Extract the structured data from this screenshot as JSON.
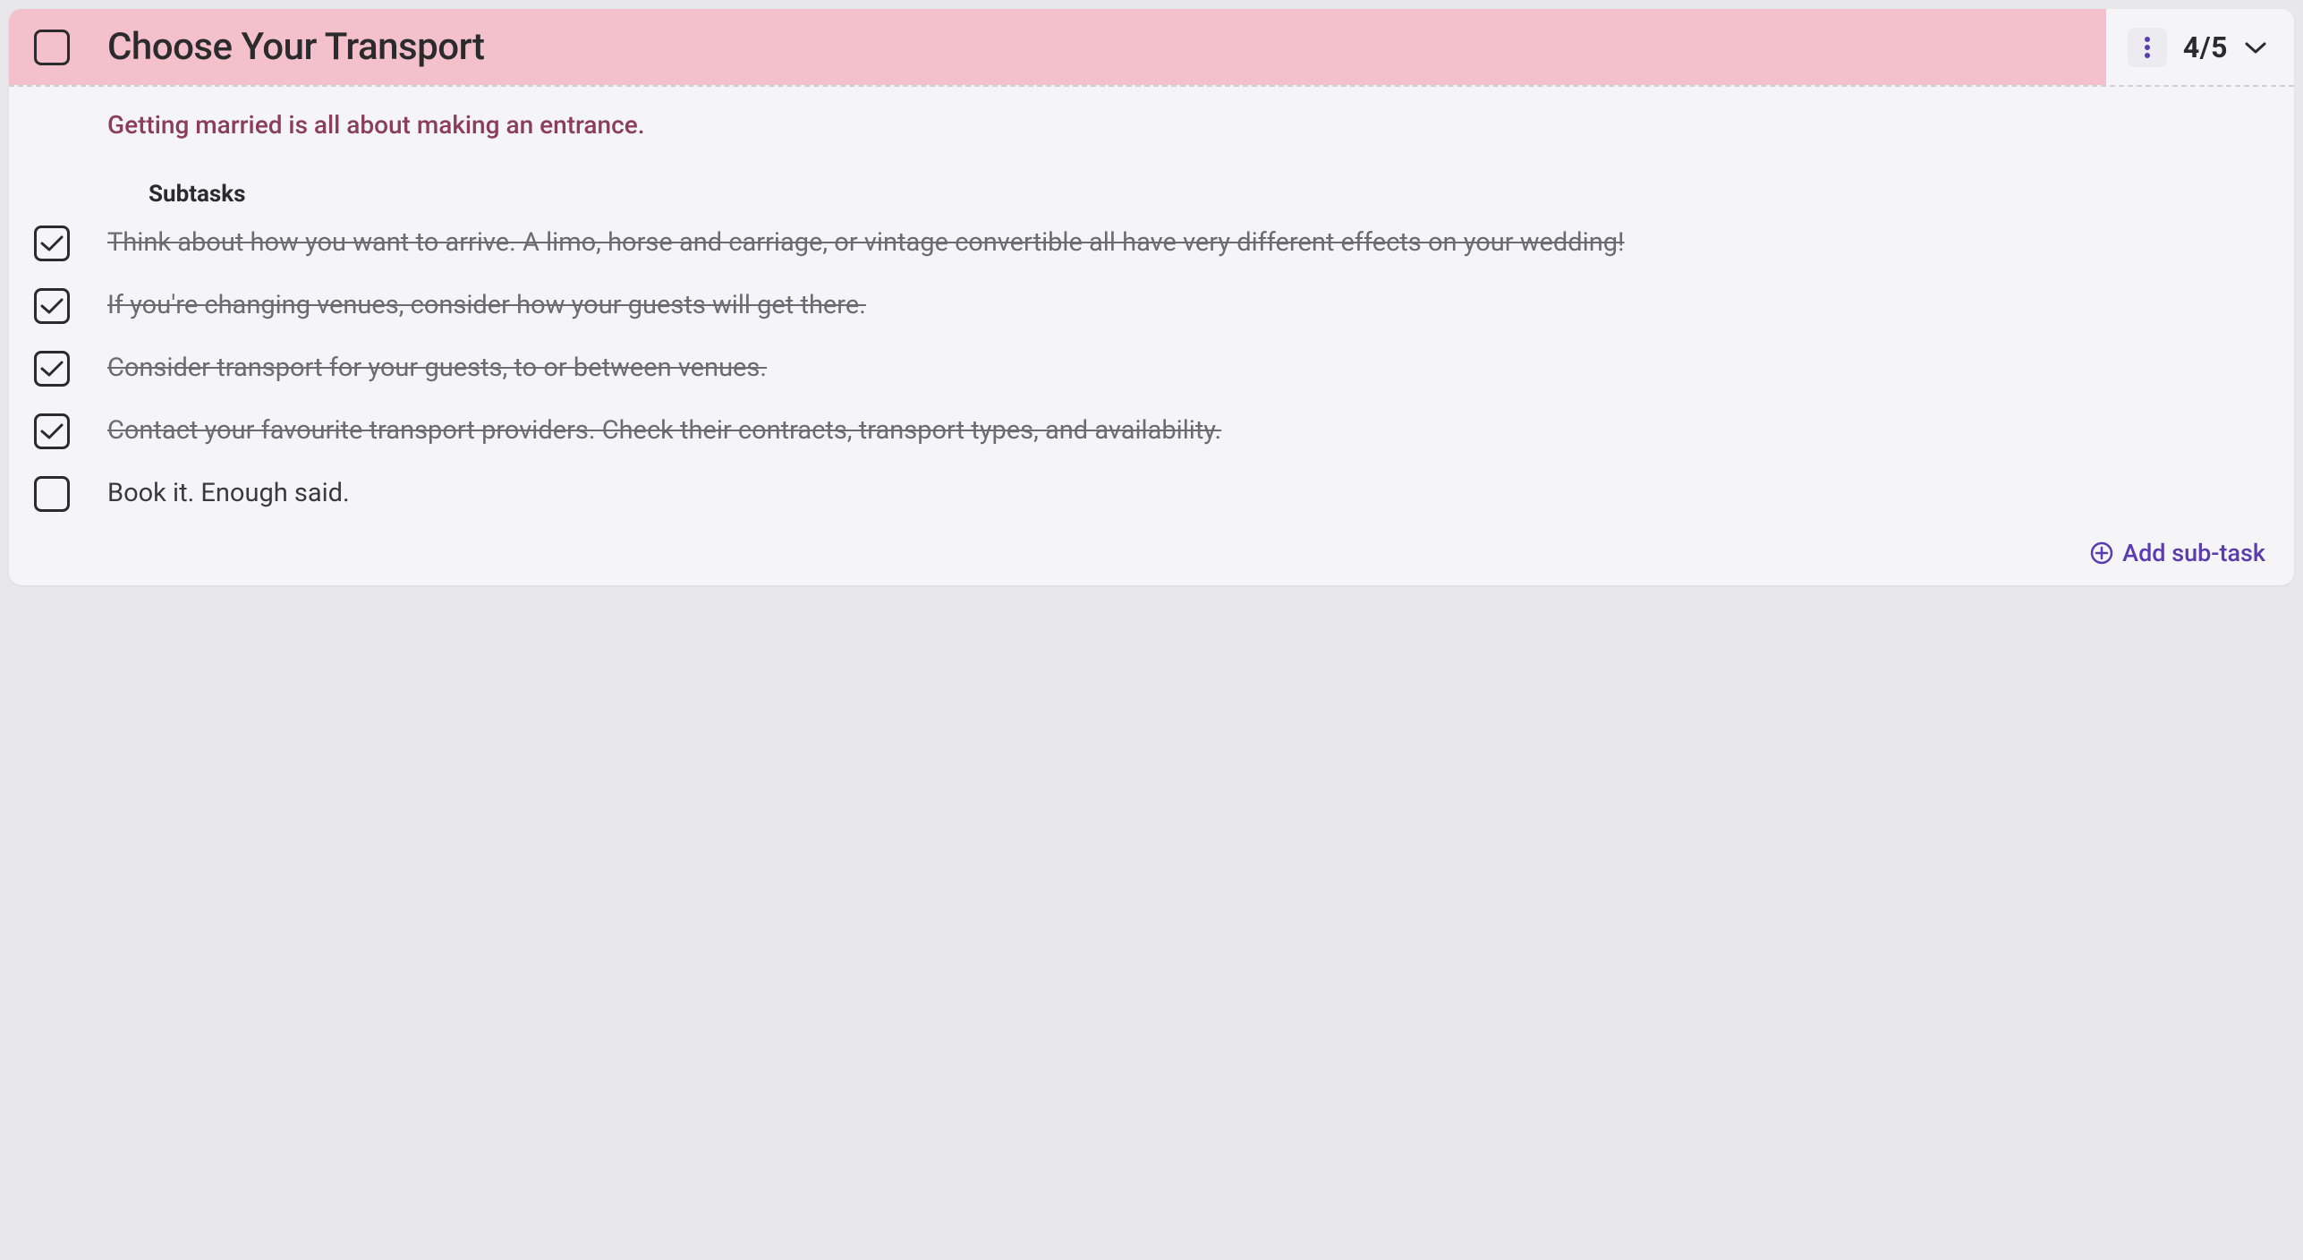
{
  "task": {
    "title": "Choose Your Transport",
    "completed": false,
    "progress": "4/5",
    "description": "Getting married is all about making an entrance."
  },
  "subtasks_heading": "Subtasks",
  "subtasks": [
    {
      "text": "Think about how you want to arrive. A limo, horse and carriage, or vintage convertible all have very different effects on your wedding!",
      "done": true
    },
    {
      "text": "If you're changing venues, consider how your guests will get there.",
      "done": true
    },
    {
      "text": "Consider transport for your guests, to or between venues.",
      "done": true
    },
    {
      "text": "Contact your favourite transport providers. Check their contracts, transport types, and availability.",
      "done": true
    },
    {
      "text": "Book it. Enough said.",
      "done": false
    }
  ],
  "add_subtask_label": "Add sub-task",
  "colors": {
    "header_bg": "#f3c0cc",
    "accent": "#5a3cb0",
    "description": "#8a3e58"
  }
}
